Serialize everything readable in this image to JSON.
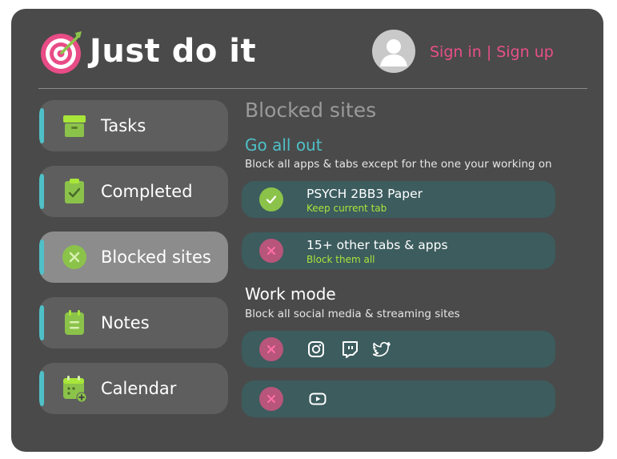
{
  "app": {
    "title": "Just do it"
  },
  "auth": {
    "sign_in": "Sign in",
    "separator": "|",
    "sign_up": "Sign up"
  },
  "colors": {
    "accent_teal": "#4fc0c8",
    "accent_pink": "#ea4f88",
    "accent_green": "#8bc34a",
    "sub_green": "#a8e63a"
  },
  "sidebar": {
    "items": [
      {
        "label": "Tasks",
        "icon": "archive-box-icon",
        "active": false
      },
      {
        "label": "Completed",
        "icon": "clipboard-check-icon",
        "active": false
      },
      {
        "label": "Blocked sites",
        "icon": "x-circle-icon",
        "active": true
      },
      {
        "label": "Notes",
        "icon": "note-icon",
        "active": false
      },
      {
        "label": "Calendar",
        "icon": "calendar-add-icon",
        "active": false
      }
    ]
  },
  "main": {
    "title": "Blocked sites",
    "go_all_out": {
      "heading": "Go all out",
      "description": "Block all apps & tabs except for the one your working on",
      "cards": [
        {
          "title": "PSYCH 2BB3 Paper",
          "subtitle": "Keep current tab",
          "status": "allowed",
          "status_icon": "check-icon"
        },
        {
          "title": "15+ other tabs & apps",
          "subtitle": "Block them all",
          "status": "blocked",
          "status_icon": "x-icon"
        }
      ]
    },
    "work_mode": {
      "heading": "Work mode",
      "description": "Block all social media & streaming sites",
      "rows": [
        {
          "status": "blocked",
          "status_icon": "x-icon",
          "sites": [
            "instagram-icon",
            "twitch-icon",
            "twitter-icon"
          ]
        },
        {
          "status": "blocked",
          "status_icon": "x-icon",
          "sites": [
            "youtube-icon"
          ]
        }
      ]
    }
  }
}
